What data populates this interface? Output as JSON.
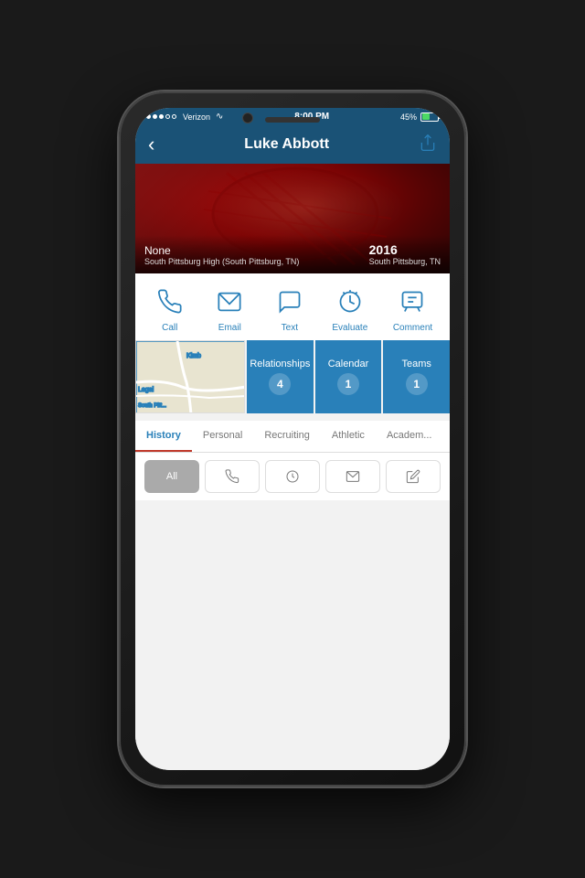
{
  "status": {
    "carrier": "Verizon",
    "time": "8:00 PM",
    "battery": "45%",
    "dots": [
      "filled",
      "filled",
      "filled",
      "empty",
      "empty"
    ]
  },
  "header": {
    "back_label": "‹",
    "title": "Luke Abbott",
    "share_label": "⬆"
  },
  "profile": {
    "tag": "None",
    "year": "2016",
    "school": "South Pittsburg High (South Pittsburg, TN)",
    "location": "South Pittsburg, TN"
  },
  "actions": [
    {
      "id": "call",
      "label": "Call",
      "icon": "phone-icon"
    },
    {
      "id": "email",
      "label": "Email",
      "icon": "email-icon"
    },
    {
      "id": "text",
      "label": "Text",
      "icon": "text-icon"
    },
    {
      "id": "evaluate",
      "label": "Evaluate",
      "icon": "evaluate-icon"
    },
    {
      "id": "comment",
      "label": "Comment",
      "icon": "comment-icon"
    }
  ],
  "cards": [
    {
      "id": "relationships",
      "label": "Relationships",
      "count": "4"
    },
    {
      "id": "calendar",
      "label": "Calendar",
      "count": "1"
    },
    {
      "id": "teams",
      "label": "Teams",
      "count": "1"
    }
  ],
  "tabs": [
    {
      "id": "history",
      "label": "History",
      "active": true
    },
    {
      "id": "personal",
      "label": "Personal",
      "active": false
    },
    {
      "id": "recruiting",
      "label": "Recruiting",
      "active": false
    },
    {
      "id": "athletic",
      "label": "Athletic",
      "active": false
    },
    {
      "id": "academic",
      "label": "Academ...",
      "active": false
    }
  ],
  "filters": [
    {
      "id": "all",
      "label": "All",
      "active": true
    },
    {
      "id": "phone",
      "label": "",
      "icon": "phone-filter-icon",
      "active": false
    },
    {
      "id": "clock",
      "label": "",
      "icon": "clock-filter-icon",
      "active": false
    },
    {
      "id": "mail",
      "label": "",
      "icon": "mail-filter-icon",
      "active": false
    },
    {
      "id": "edit",
      "label": "",
      "icon": "edit-filter-icon",
      "active": false
    }
  ],
  "map": {
    "labels": [
      "Kimb",
      "Legal",
      "South Pitt..."
    ]
  }
}
